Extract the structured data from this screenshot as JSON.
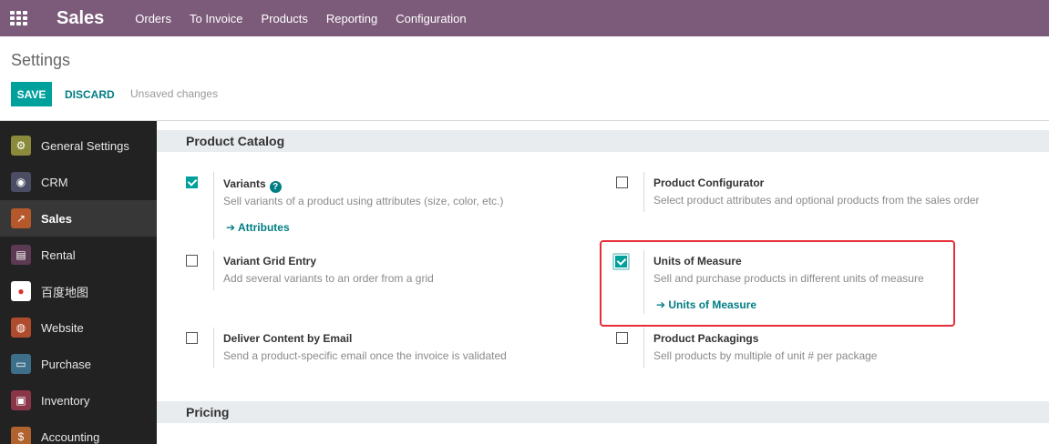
{
  "navbar": {
    "brand": "Sales",
    "menu": [
      "Orders",
      "To Invoice",
      "Products",
      "Reporting",
      "Configuration"
    ]
  },
  "control_panel": {
    "title": "Settings",
    "save_label": "SAVE",
    "discard_label": "DISCARD",
    "status": "Unsaved changes"
  },
  "sidebar": {
    "items": [
      {
        "label": "General Settings",
        "icon": "gear-icon",
        "color": "#6e6e2e"
      },
      {
        "label": "CRM",
        "icon": "crm-icon",
        "color": "#4a4d63"
      },
      {
        "label": "Sales",
        "icon": "sales-chart-icon",
        "color": "#b5582b"
      },
      {
        "label": "Rental",
        "icon": "rental-icon",
        "color": "#5c3a53"
      },
      {
        "label": "百度地图",
        "icon": "map-pin-icon",
        "color": "#ffffff"
      },
      {
        "label": "Website",
        "icon": "globe-icon",
        "color": "#b04c2e"
      },
      {
        "label": "Purchase",
        "icon": "purchase-icon",
        "color": "#3e6f8a"
      },
      {
        "label": "Inventory",
        "icon": "inventory-box-icon",
        "color": "#8a3548"
      },
      {
        "label": "Accounting",
        "icon": "accounting-icon",
        "color": "#b0632e"
      }
    ],
    "active_index": 2
  },
  "sections": {
    "product_catalog": "Product Catalog",
    "pricing": "Pricing"
  },
  "settings": {
    "variants": {
      "title": "Variants",
      "desc": "Sell variants of a product using attributes (size, color, etc.)",
      "link": "Attributes",
      "checked": true
    },
    "product_configurator": {
      "title": "Product Configurator",
      "desc": "Select product attributes and optional products from the sales order",
      "checked": false
    },
    "variant_grid": {
      "title": "Variant Grid Entry",
      "desc": "Add several variants to an order from a grid",
      "checked": false
    },
    "uom": {
      "title": "Units of Measure",
      "desc": "Sell and purchase products in different units of measure",
      "link": "Units of Measure",
      "checked": true
    },
    "deliver_content": {
      "title": "Deliver Content by Email",
      "desc": "Send a product-specific email once the invoice is validated",
      "checked": false
    },
    "packagings": {
      "title": "Product Packagings",
      "desc": "Sell products by multiple of unit # per package",
      "checked": false
    }
  },
  "colors": {
    "navbar": "#7c5b7a",
    "accent": "#00a09d",
    "link": "#017e84",
    "highlight": "#e62e3a"
  }
}
